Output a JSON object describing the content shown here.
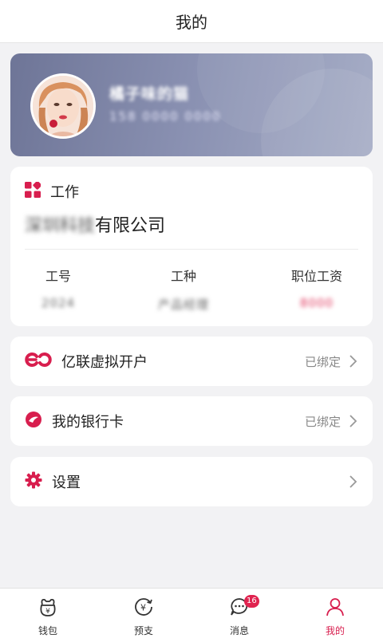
{
  "header": {
    "title": "我的"
  },
  "profile": {
    "name": "橘子味的猫",
    "phone": "158 0000 0000"
  },
  "work": {
    "title": "工作",
    "company_blurred": "深圳科技",
    "company_suffix": "有限公司",
    "columns": [
      {
        "label": "工号",
        "value": "2024"
      },
      {
        "label": "工种",
        "value": "产品经理"
      },
      {
        "label": "职位工资",
        "value": "8000"
      }
    ]
  },
  "menu": [
    {
      "label": "亿联虚拟开户",
      "status": "已绑定",
      "icon": "yilian-logo-icon"
    },
    {
      "label": "我的银行卡",
      "status": "已绑定",
      "icon": "bank-card-icon"
    },
    {
      "label": "设置",
      "status": "",
      "icon": "gear-icon"
    }
  ],
  "tabs": [
    {
      "label": "钱包",
      "icon": "wallet-icon"
    },
    {
      "label": "预支",
      "icon": "advance-icon"
    },
    {
      "label": "消息",
      "icon": "message-icon",
      "badge": "16"
    },
    {
      "label": "我的",
      "icon": "user-icon",
      "active": true
    }
  ],
  "colors": {
    "accent": "#d81e4e",
    "profile_gradient_start": "#6e7597",
    "profile_gradient_end": "#a6adc6"
  }
}
